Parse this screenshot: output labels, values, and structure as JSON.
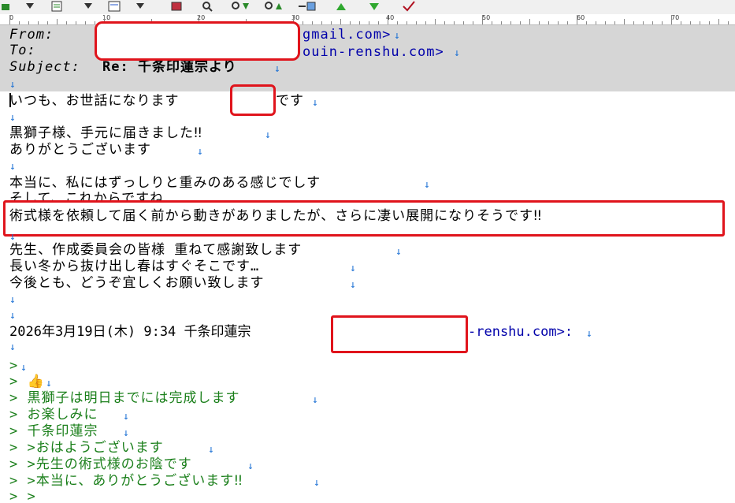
{
  "toolbar": {
    "icons": [
      "reply-icon",
      "dropdown-icon",
      "compose-icon",
      "dropdown-icon",
      "note-icon",
      "print-icon",
      "search-icon",
      "search-down-icon",
      "search-up-icon",
      "attach-icon",
      "prev-up-icon",
      "next-down-icon",
      "check-icon"
    ]
  },
  "ruler": {
    "labels": [
      "0",
      "10",
      "20",
      "30",
      "40",
      "50",
      "60",
      "70"
    ]
  },
  "header": {
    "from_label": "From:",
    "from_addr": "gmail.com>",
    "to_label": "To:",
    "to_addr": "ouin-renshu.com>",
    "subject_label": "Subject:",
    "subject_value": "Re: 千条印蓮宗より"
  },
  "body": {
    "l1a": "いつも、お世話になります",
    "l1b": "です",
    "l2": "黒獅子様、手元に届きました‼",
    "l3": "ありがとうございます",
    "l4": "本当に、私にはずっしりと重みのある感じでしす",
    "l5": "そして、これからですね…",
    "l6": "術式様を依頼して届く前から動きがありましたが、さらに凄い展開になりそうです‼",
    "l7": "先生、作成委員会の皆様 重ねて感謝致します",
    "l8": "長い冬から抜け出し春はすぐそこです…",
    "l9": "今後とも、どうぞ宜しくお願い致します",
    "date_line": "2026年3月19日(木) 9:34 千条印蓮宗",
    "date_tail": "-renshu.com>:"
  },
  "quoted": {
    "q0": ">",
    "q1": "> 👍",
    "q2": "> 黒獅子は明日までには完成します",
    "q3": "> お楽しみに",
    "q4": "> 千条印蓮宗",
    "q5": "> >おはようございます",
    "q6": "> >先生の術式様のお陰です",
    "q7": "> >本当に、ありがとうございます‼",
    "q8": "> >"
  },
  "glyphs": {
    "newline": "↓"
  },
  "colors": {
    "header_bg": "#d6d6d6",
    "quote": "#1a7f1a",
    "redaction": "#e0141c",
    "link": "#0000aa"
  }
}
